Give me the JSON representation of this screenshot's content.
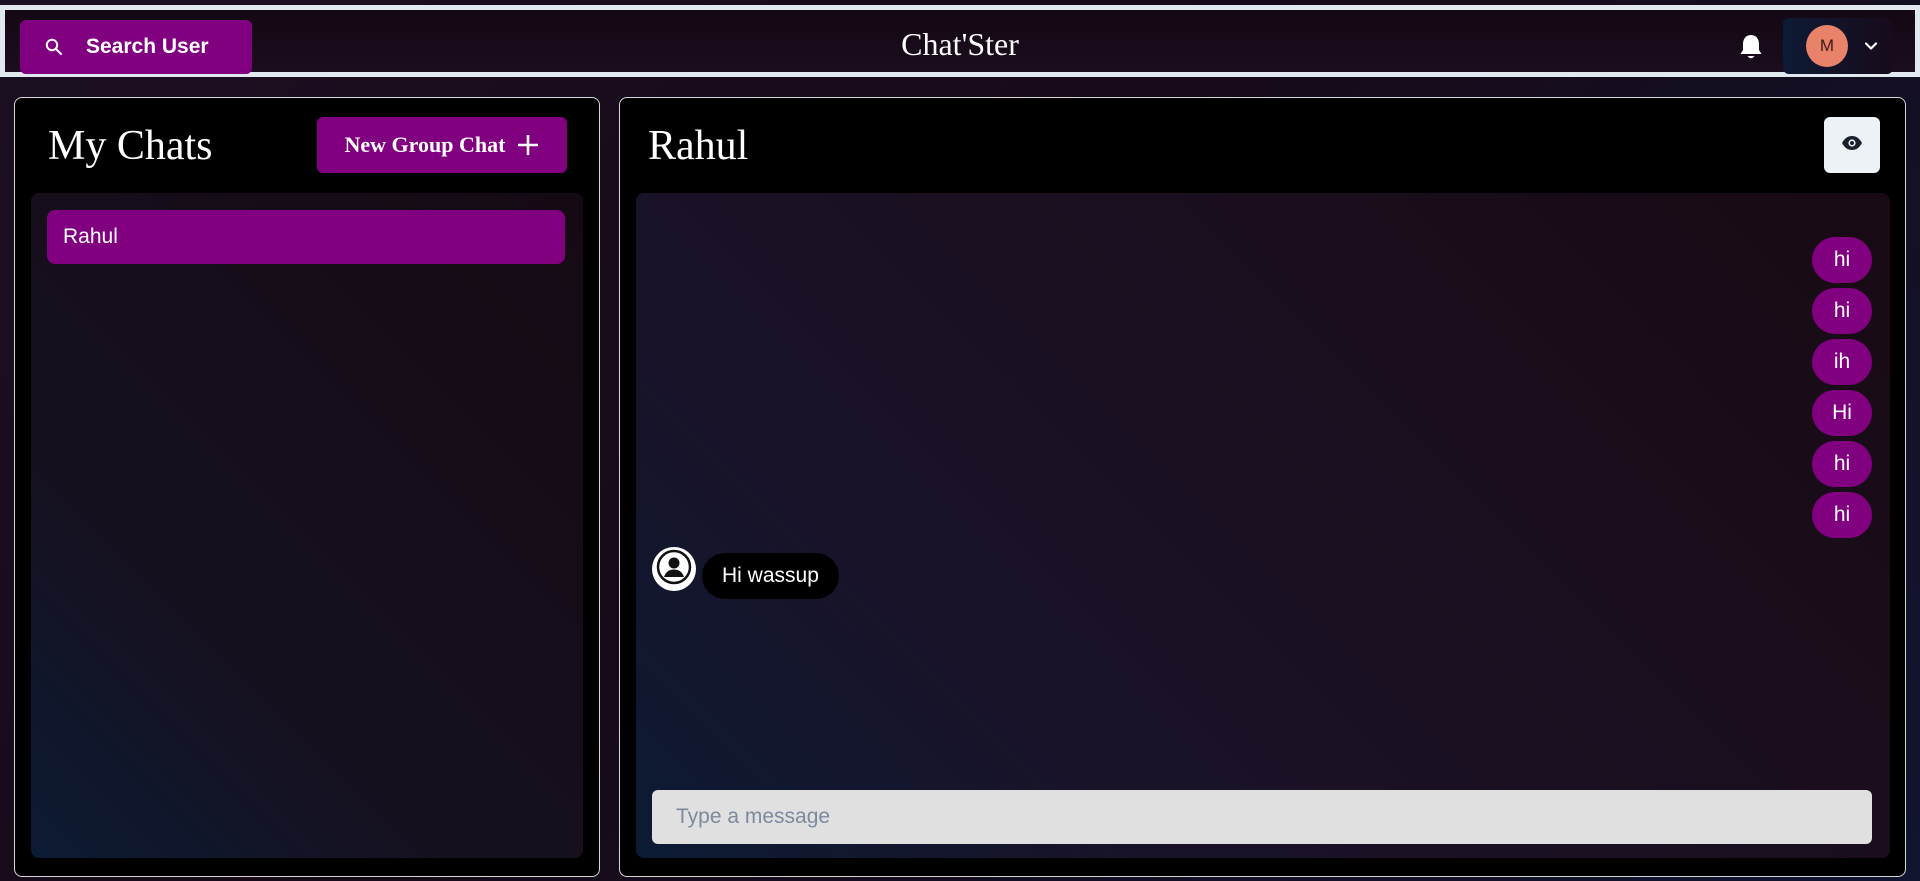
{
  "header": {
    "search_label": "Search User",
    "app_title": "Chat'Ster",
    "avatar_initial": "M"
  },
  "sidebar": {
    "title": "My Chats",
    "new_group_label": "New Group Chat",
    "chats": [
      {
        "name": "Rahul",
        "selected": true
      }
    ]
  },
  "chat": {
    "title": "Rahul",
    "sent_messages": [
      "hi",
      "hi",
      "ih",
      "Hi",
      "hi",
      "hi"
    ],
    "received_messages": [
      "Hi wassup"
    ],
    "input_placeholder": "Type a message",
    "input_value": ""
  },
  "colors": {
    "accent": "#800080",
    "avatar": "#e8836a",
    "input_bg": "#e0e0e0",
    "header_border": "#e2e8f0"
  },
  "icons": {
    "search": "search-icon",
    "bell": "bell-icon",
    "chevron": "chevron-down-icon",
    "plus": "plus-icon",
    "eye": "eye-icon",
    "user": "user-circle-icon"
  }
}
